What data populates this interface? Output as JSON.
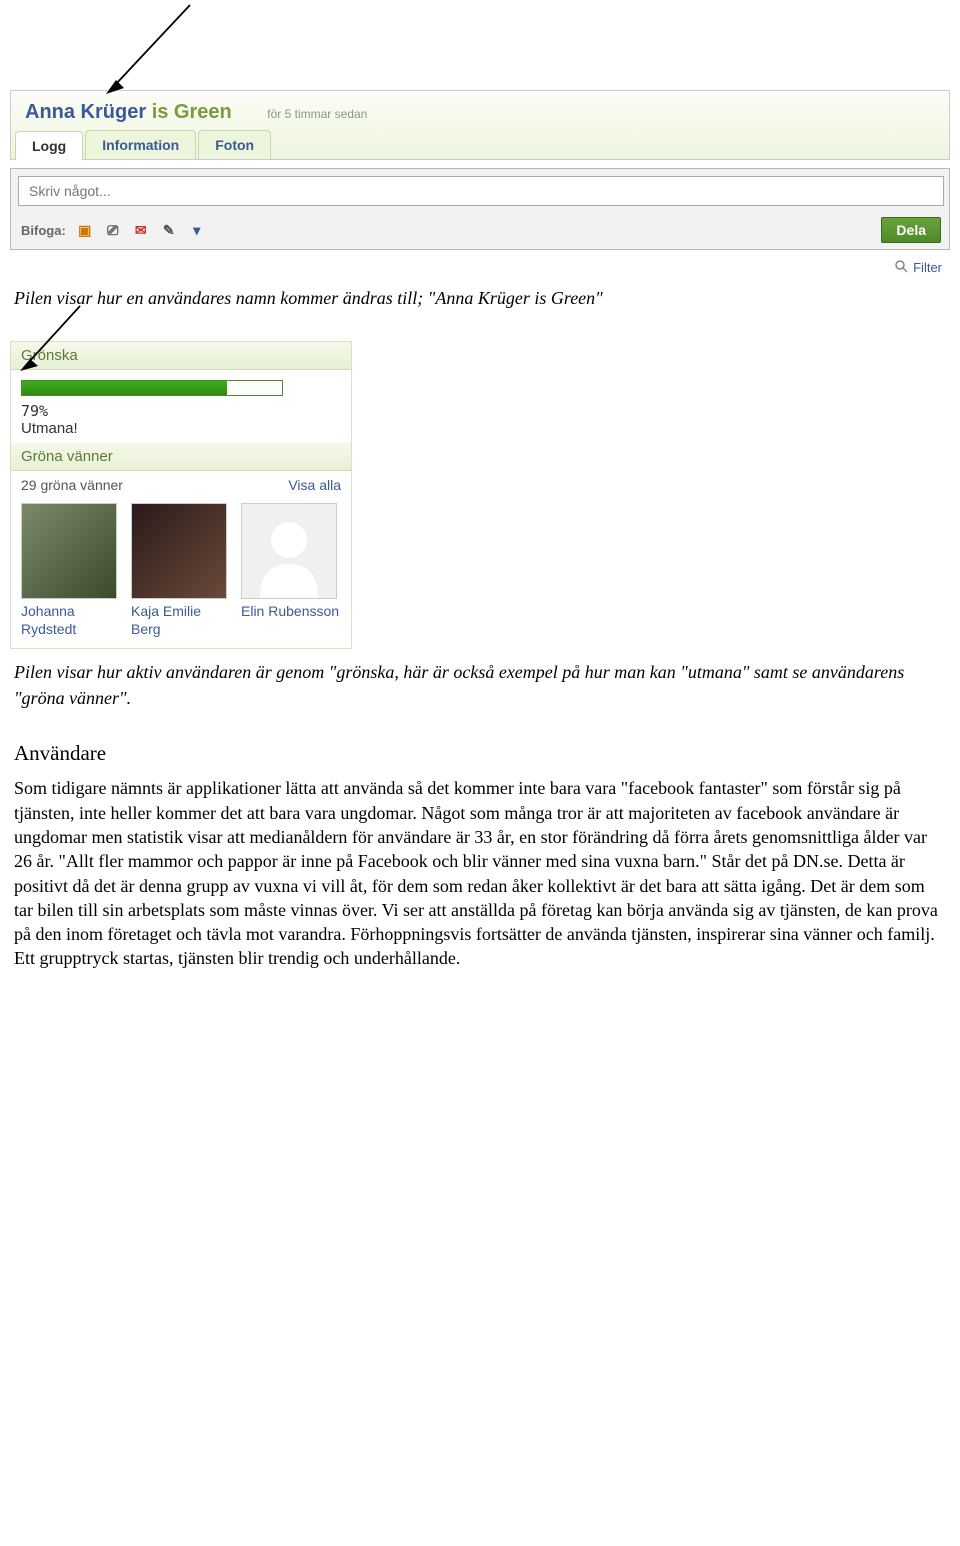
{
  "profile": {
    "name": "Anna Krüger",
    "status": "is Green",
    "timestamp": "för 5 timmar sedan",
    "tabs": {
      "log": "Logg",
      "info": "Information",
      "photos": "Foton"
    }
  },
  "composer": {
    "placeholder": "Skriv något...",
    "attach_label": "Bifoga:",
    "share_label": "Dela"
  },
  "filter": {
    "label": "Filter"
  },
  "caption1": "Pilen visar hur en användares namn kommer ändras till; \"Anna Krüger is Green\"",
  "sidebar": {
    "gronska_title": "Grönska",
    "progress_percent": "79%",
    "challenge": "Utmana!",
    "friends_title": "Gröna vänner",
    "friends_count": "29 gröna vänner",
    "show_all": "Visa alla",
    "friends": [
      {
        "name": "Johanna Rydstedt"
      },
      {
        "name": "Kaja Emilie Berg"
      },
      {
        "name": "Elin Rubensson"
      }
    ]
  },
  "caption2": "Pilen visar hur aktiv användaren är genom \"grönska, här är också exempel på hur man kan \"utmana\" samt se användarens \"gröna vänner\".",
  "section_title": "Användare",
  "body_text": "Som tidigare nämnts är applikationer lätta att använda så det kommer inte bara vara \"facebook fantaster\" som förstår sig på tjänsten, inte heller kommer det att bara vara ungdomar. Något som många tror är att majoriteten av facebook användare är ungdomar men statistik visar att medianåldern för användare är 33 år, en stor förändring då förra årets genomsnittliga ålder var 26 år. \"Allt fler mammor och pappor är inne på Facebook och blir vänner med sina vuxna barn.\" Står det på DN.se. Detta är positivt då det är denna grupp av vuxna vi vill åt, för dem som redan åker kollektivt är det bara att sätta igång. Det är dem som tar bilen till sin arbetsplats som måste vinnas över. Vi ser att anställda på företag kan börja använda sig av tjänsten, de kan prova på den inom företaget och tävla mot varandra. Förhoppningsvis fortsätter de använda tjänsten, inspirerar sina vänner och familj. Ett grupptryck startas, tjänsten blir trendig och underhållande."
}
